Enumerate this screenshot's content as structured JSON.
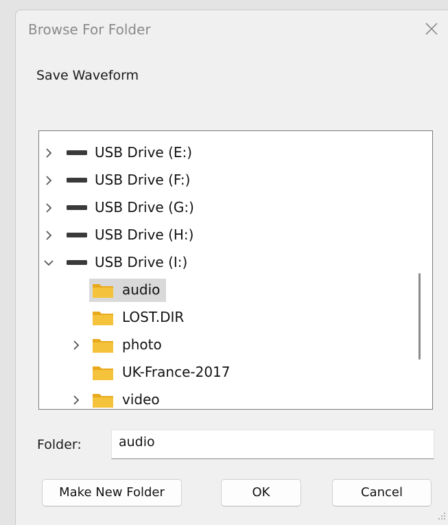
{
  "dialog": {
    "title": "Browse For Folder",
    "prompt": "Save Waveform"
  },
  "tree": {
    "items": [
      {
        "label": "USB Drive (E:)",
        "type": "drive",
        "expander": "collapsed",
        "selected": false
      },
      {
        "label": "USB Drive (F:)",
        "type": "drive",
        "expander": "collapsed",
        "selected": false
      },
      {
        "label": "USB Drive (G:)",
        "type": "drive",
        "expander": "collapsed",
        "selected": false
      },
      {
        "label": "USB Drive (H:)",
        "type": "drive",
        "expander": "collapsed",
        "selected": false
      },
      {
        "label": "USB Drive (I:)",
        "type": "drive",
        "expander": "expanded",
        "selected": false
      },
      {
        "label": "audio",
        "type": "folder",
        "expander": "none",
        "selected": true
      },
      {
        "label": "LOST.DIR",
        "type": "folder",
        "expander": "none",
        "selected": false
      },
      {
        "label": "photo",
        "type": "folder",
        "expander": "collapsed",
        "selected": false
      },
      {
        "label": "UK-France-2017",
        "type": "folder",
        "expander": "none",
        "selected": false
      },
      {
        "label": "video",
        "type": "folder",
        "expander": "collapsed",
        "selected": false
      }
    ]
  },
  "folder": {
    "label": "Folder:",
    "value": "audio"
  },
  "buttons": {
    "make_new_folder": "Make New Folder",
    "ok": "OK",
    "cancel": "Cancel"
  },
  "colors": {
    "folder_icon": "#f5c33b",
    "folder_icon_tab": "#e8a91c",
    "selection": "#d9d9d9",
    "dialog_bg": "#f0f0f0"
  }
}
